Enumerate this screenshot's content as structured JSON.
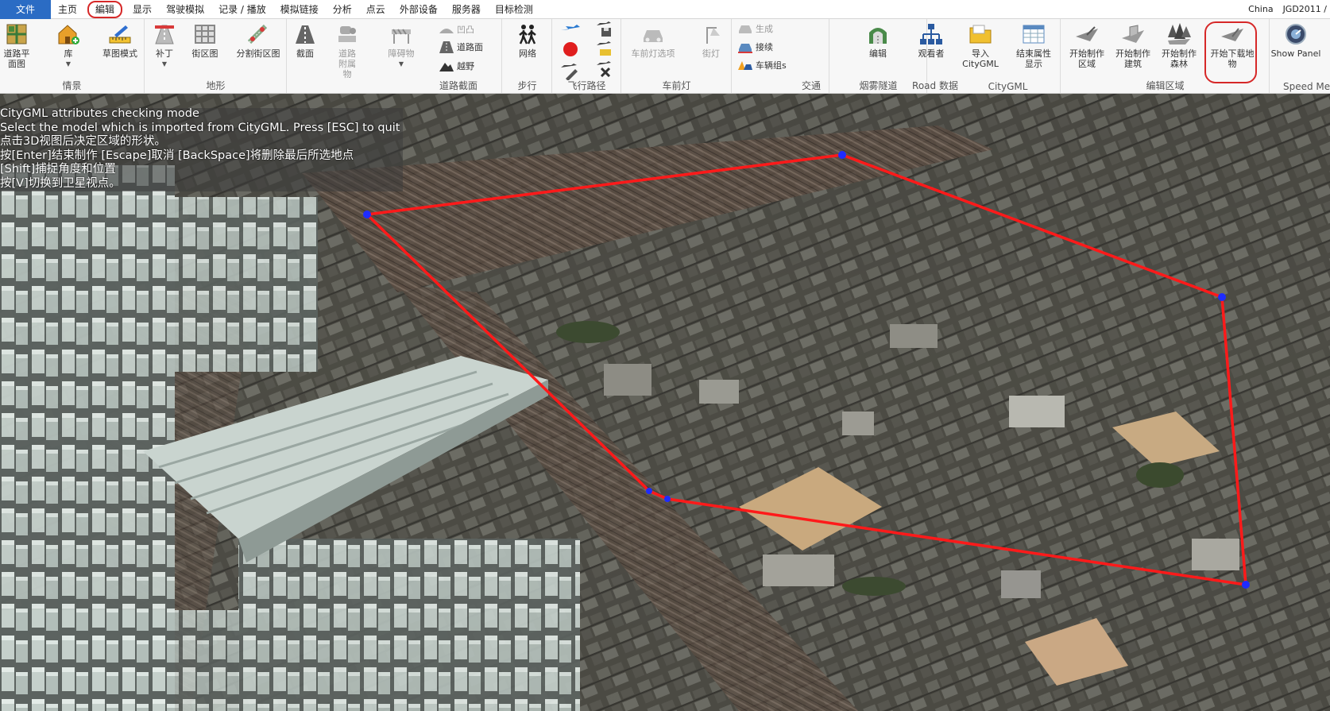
{
  "menu": {
    "items": [
      "文件",
      "主页",
      "編辑",
      "显示",
      "驾驶模拟",
      "记录 / 播放",
      "模拟链接",
      "分析",
      "点云",
      "外部设备",
      "服务器",
      "目标检测"
    ],
    "active_index": 2,
    "right": [
      "China",
      "JGD2011 /"
    ]
  },
  "ribbon": {
    "groups": {
      "scene": "情景",
      "terrain": "地形",
      "road_section": "道路截面",
      "walk": "步行",
      "flight_path": "飞行路径",
      "headlight": "车前灯",
      "traffic": "交通",
      "smoke_tunnel": "烟雾隧道",
      "road_data": "Road 数据",
      "citygml": "CityGML",
      "edit_area": "编辑区域",
      "speed_meter": "Speed Mete"
    },
    "buttons": {
      "road_plan": "道路平面图",
      "library": "库",
      "sketch_mode": "草图模式",
      "patch": "补丁",
      "block_plan": "街区图",
      "split_block_plan": "分割街区图",
      "cross_section": "截面",
      "road_attachment": "道路附属物",
      "obstacle": "障碍物",
      "bump": "凹凸",
      "road_surface": "道路面",
      "off_road": "越野",
      "network": "网络",
      "headlight_options": "车前灯选项",
      "street_light": "街灯",
      "generate": "生成",
      "connect": "接续",
      "vehicle_group": "车辆组s",
      "edit": "编辑",
      "viewer": "观看者",
      "import_citygml": "导入 CityGML",
      "end_attribute_display": "结束属性显示",
      "start_area": "开始制作区域",
      "start_building": "开始制作建筑",
      "start_forest": "开始制作森林",
      "start_underground": "开始下载地物",
      "show_panel": "Show Panel"
    }
  },
  "overlay_lines": [
    "CityGML attributes checking mode",
    "Select the model which is imported from CityGML. Press [ESC] to quit",
    "点击3D视图后决定区域的形状。",
    "按[Enter]结束制作   [Escape]取消   [BackSpace]将删除最后所选地点",
    "[Shift]捕捉角度和位置",
    "按[V]切换到卫星视点。"
  ],
  "colors": {
    "accent": "#2b6cc4",
    "highlight": "#d62828",
    "polygon": "#ff1a1a",
    "vertex": "#1e2bff"
  }
}
